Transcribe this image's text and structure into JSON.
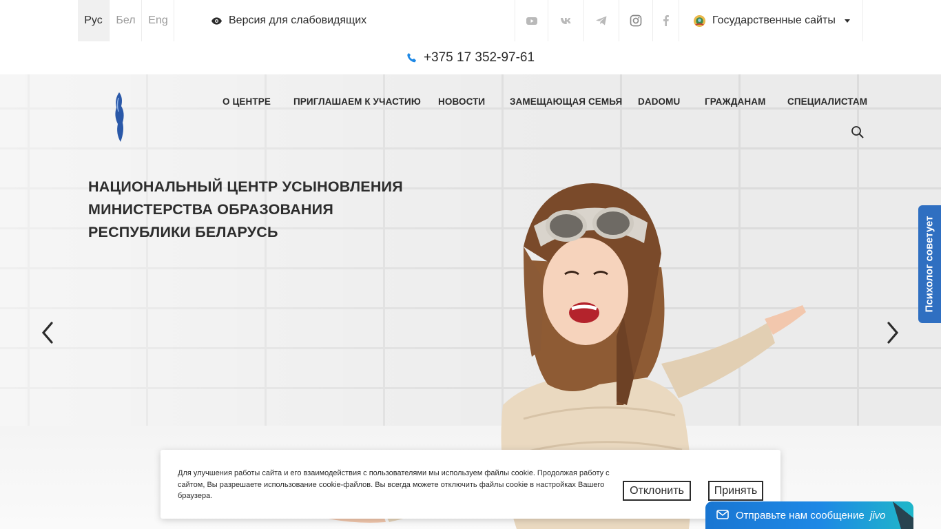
{
  "topbar": {
    "languages": [
      {
        "label": "Рус",
        "active": true
      },
      {
        "label": "Бел",
        "active": false
      },
      {
        "label": "Eng",
        "active": false
      }
    ],
    "low_vision_label": "Версия для слабовидящих",
    "social_icons": [
      "youtube-icon",
      "vk-icon",
      "telegram-icon",
      "instagram-icon",
      "facebook-icon"
    ],
    "gov_sites_label": "Государственные сайты"
  },
  "phone": "+375 17 352-97-61",
  "nav": {
    "items": [
      "О ЦЕНТРЕ",
      "ПРИГЛАШАЕМ К УЧАСТИЮ",
      "НОВОСТИ",
      "ЗАМЕЩАЮЩАЯ СЕМЬЯ",
      "DADOMU",
      "ГРАЖДАНАМ",
      "СПЕЦИАЛИСТАМ"
    ]
  },
  "hero": {
    "title_lines": [
      "НАЦИОНАЛЬНЫЙ ЦЕНТР УСЫНОВЛЕНИЯ",
      "МИНИСТЕРСТВА ОБРАЗОВАНИЯ",
      "РЕСПУБЛИКИ БЕЛАРУСЬ"
    ]
  },
  "side_tab_label": "Психолог советует",
  "cookie": {
    "text": "Для улучшения работы сайта и его взаимодействия с пользователями мы используем файлы cookie. Продолжая работу с сайтом, Вы разрешаете использование cookie-файлов. Вы всегда можете отключить файлы cookie в настройках Вашего браузера.",
    "decline_label": "Отклонить",
    "accept_label": "Принять"
  },
  "chat": {
    "label": "Отправьте нам сообщение",
    "brand": "jivo"
  },
  "colors": {
    "accent_blue": "#2f6fc1",
    "phone_icon": "#1e88e5",
    "chat_blue": "#1e88e5"
  }
}
